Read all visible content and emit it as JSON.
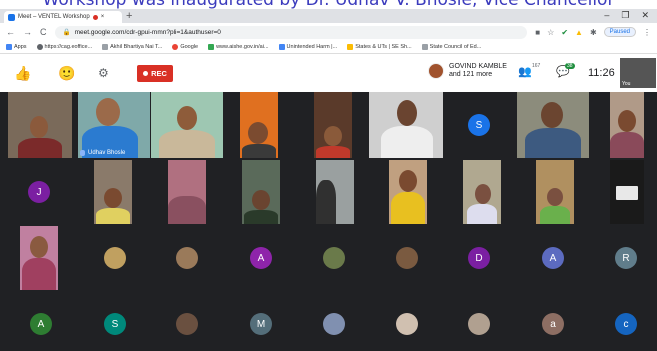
{
  "caption": "Workshop was inaugurated by Dr. Udhav V. Bhosle, Vice Chancellor",
  "browser": {
    "tab_title": "Meet – VENTEL Workshop",
    "new_tab": "+",
    "window_controls": [
      "–",
      "❐",
      "✕"
    ],
    "url": "meet.google.com/cdr-gpui-mmn?pli=1&authuser=0",
    "paused_label": "Paused",
    "nav": [
      "←",
      "→",
      "C"
    ]
  },
  "bookmarks": [
    {
      "label": "Apps",
      "color": "#4285f4"
    },
    {
      "label": "https://cag.eoffice...",
      "color": "#5f6368"
    },
    {
      "label": "Akhil Bhartiya Nai T...",
      "color": "#9aa0a6"
    },
    {
      "label": "Google",
      "color": "#ea4335"
    },
    {
      "label": "www.aishe.gov.in/ai...",
      "color": "#34a853"
    },
    {
      "label": "Unintended Harm |...",
      "color": "#4285f4"
    },
    {
      "label": "States & UTs | SE Sh...",
      "color": "#fbbc04"
    },
    {
      "label": "State Council of Ed...",
      "color": "#9aa0a6"
    }
  ],
  "meet": {
    "rec_label": "REC",
    "host_name": "GOVIND KAMBLE",
    "host_more": "and 121 more",
    "participants_count": "167",
    "chat_count": "38",
    "time": "11:26",
    "self_label": "You"
  },
  "speaker": {
    "name": "Udhav Bhosle"
  },
  "avatars": [
    {
      "letter": "S",
      "color": "#1a73e8"
    },
    {
      "letter": "J",
      "color": "#7b1fa2"
    },
    {
      "letter": "A",
      "color": "#8e24aa"
    },
    {
      "letter": "D",
      "color": "#7b1fa2"
    },
    {
      "letter": "A",
      "color": "#5c6bc0"
    },
    {
      "letter": "R",
      "color": "#607d8b"
    },
    {
      "letter": "A",
      "color": "#2e7d32"
    },
    {
      "letter": "S",
      "color": "#00897b"
    },
    {
      "letter": "M",
      "color": "#546e7a"
    },
    {
      "letter": "a",
      "color": "#8d6e63"
    },
    {
      "letter": "c",
      "color": "#1565c0"
    }
  ]
}
